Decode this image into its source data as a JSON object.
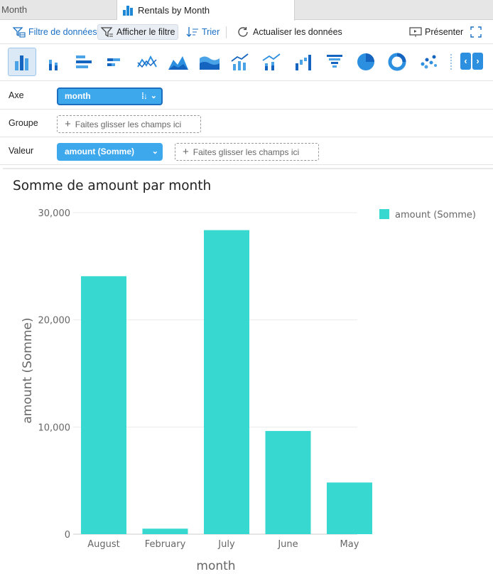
{
  "tabs": [
    {
      "label": "Month"
    },
    {
      "label": "Rentals by Month"
    }
  ],
  "toolbar": {
    "filter_data": "Filtre de données",
    "show_filter": "Afficher le filtre",
    "sort": "Trier",
    "refresh": "Actualiser les données",
    "present": "Présenter"
  },
  "chart_types": [
    "bar-vertical",
    "bar-stacked",
    "bar-horizontal",
    "bar-horizontal-stacked",
    "line",
    "area",
    "area-stacked",
    "line-bar",
    "line-bar-stacked",
    "waterfall",
    "funnel",
    "pie",
    "donut",
    "scatter"
  ],
  "fields": {
    "axe": {
      "label": "Axe",
      "value": "month"
    },
    "groupe": {
      "label": "Groupe",
      "placeholder": "Faites glisser les champs ici"
    },
    "valeur": {
      "label": "Valeur",
      "value": "amount (Somme)",
      "placeholder": "Faites glisser les champs ici"
    }
  },
  "colors": {
    "bar": "#36d8d0",
    "accent": "#3ea8ec",
    "link": "#1a6fc4"
  },
  "chart_data": {
    "type": "bar",
    "title": "Somme de amount par month",
    "xlabel": "month",
    "ylabel": "amount (Somme)",
    "categories": [
      "August",
      "February",
      "July",
      "June",
      "May"
    ],
    "series": [
      {
        "name": "amount (Somme)",
        "values": [
          24070,
          514,
          28370,
          9630,
          4820
        ]
      }
    ],
    "ylim": [
      0,
      30000
    ],
    "yticks": [
      0,
      10000,
      20000,
      30000
    ],
    "ytick_labels": [
      "0",
      "10,000",
      "20,000",
      "30,000"
    ],
    "grid": true,
    "legend_position": "top-right"
  }
}
